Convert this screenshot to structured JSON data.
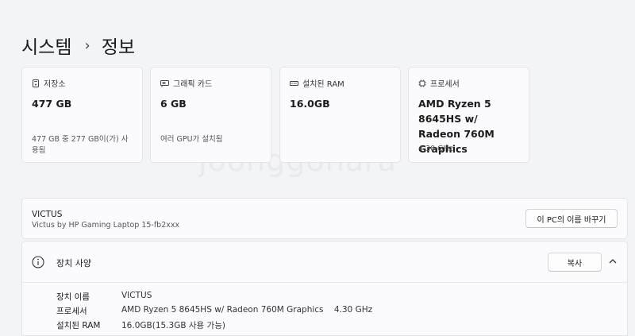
{
  "breadcrumb": {
    "parent": "시스템",
    "separator": "›",
    "current": "정보"
  },
  "cards": [
    {
      "icon": "storage-icon",
      "title": "저장소",
      "value": "477 GB",
      "sub": "477 GB 중 277 GB이(가) 사용됨"
    },
    {
      "icon": "graphics-card-icon",
      "title": "그래픽 카드",
      "value": "6 GB",
      "sub": "여러 GPU가 설치됨"
    },
    {
      "icon": "ram-icon",
      "title": "설치된 RAM",
      "value": "16.0GB",
      "sub": ""
    },
    {
      "icon": "processor-icon",
      "title": "프로세서",
      "value": "AMD Ryzen 5 8645HS w/ Radeon 760M Graphics",
      "sub": "4.30 GHz"
    }
  ],
  "device": {
    "name": "VICTUS",
    "model": "Victus by HP Gaming Laptop 15-fb2xxx",
    "rename_label": "이 PC의 이름 바꾸기"
  },
  "specs": {
    "title": "장치 사양",
    "copy_label": "복사",
    "rows": [
      {
        "label": "장치 이름",
        "value": "VICTUS"
      },
      {
        "label": "프로세서",
        "value": "AMD Ryzen 5 8645HS w/ Radeon 760M Graphics    4.30 GHz"
      },
      {
        "label": "설치된 RAM",
        "value": "16.0GB(15.3GB 사용 가능)"
      }
    ]
  },
  "watermark": "joonggonara"
}
